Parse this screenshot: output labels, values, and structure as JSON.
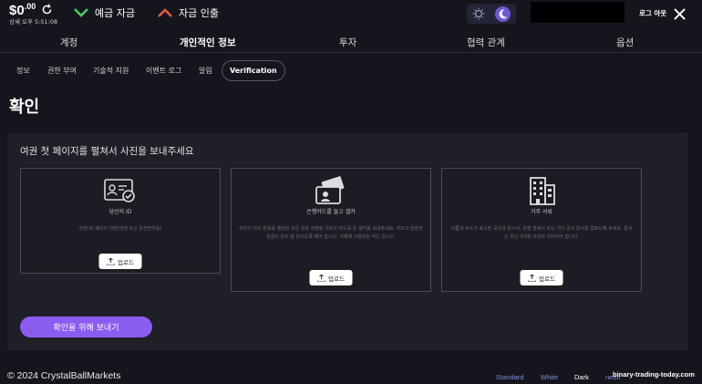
{
  "header": {
    "balance_main": "$0",
    "balance_cents": ".00",
    "time": "상세 오후 5:51:08",
    "deposit_label": "예금 자금",
    "withdraw_label": "자금 인출",
    "logout_label": "로그 아웃"
  },
  "main_nav": [
    "계정",
    "개인적인 정보",
    "투자",
    "협력 관계",
    "옵션"
  ],
  "sub_nav": [
    "정보",
    "권한 부여",
    "기술적 지원",
    "이벤트 로그",
    "알림",
    "Verification"
  ],
  "page_title": "확인",
  "instruction": "여권 첫 페이지를 펼쳐서 사진을 보내주세요",
  "cards": [
    {
      "title": "당신의 ID",
      "description": "전체 ID 페이지 한장(여권 또는 운전면허증)",
      "upload_label": "업로드",
      "icon": "id-card-icon"
    },
    {
      "title": "은행카드를 들고 셀카",
      "description": "귀하의 카드 번호를 제외한 모든 번호 부분을 가리고 카드를 든 셀카를 보내주세요. 카드의 앞면과 얼굴이 모두 잘 보이도록 해야 합니다. 거래에 사용되는 카드 입니다.",
      "upload_label": "업로드",
      "icon": "bank-card-selfie-icon"
    },
    {
      "title": "거주 서류",
      "description": "이름과 주소가 표시된 공과금 청구서, 은행 명세서 또는 기타 공식 문서를 업로드해 주세요. 문서는 최근 3개월 이내의 것이어야 합니다.",
      "upload_label": "업로드",
      "icon": "building-icon"
    }
  ],
  "submit_label": "확인을 위해 보내기",
  "footer": {
    "copyright": "© 2024 CrystalBallMarkets",
    "themes": [
      "Standard",
      "White",
      "Dark",
      "neon"
    ],
    "watermark": "binary-trading-today.com"
  },
  "colors": {
    "accent": "#8b5cf0",
    "deposit": "#4cc764",
    "withdraw": "#e35a4a",
    "theme_link": "#7d8fd8"
  }
}
